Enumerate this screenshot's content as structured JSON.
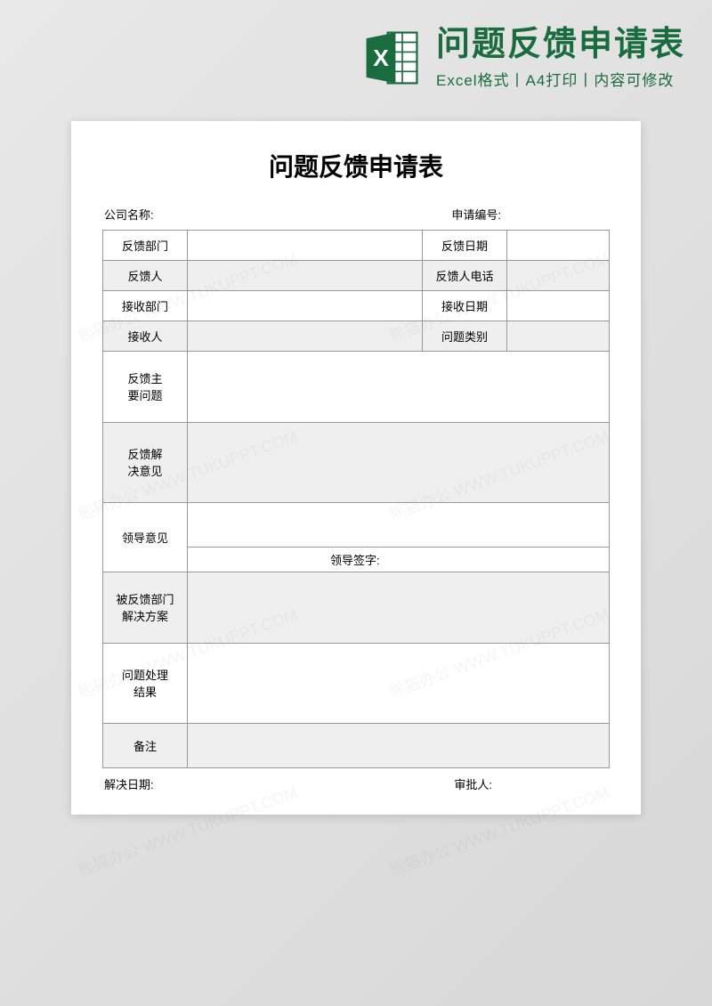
{
  "header": {
    "title": "问题反馈申请表",
    "subtitle": "Excel格式丨A4打印丨内容可修改",
    "icon_name": "excel-icon"
  },
  "form": {
    "title": "问题反馈申请表",
    "top": {
      "company_label": "公司名称:",
      "app_no_label": "申请编号:"
    },
    "rows": {
      "r1_left": "反馈部门",
      "r1_right": "反馈日期",
      "r2_left": "反馈人",
      "r2_right": "反馈人电话",
      "r3_left": "接收部门",
      "r3_right": "接收日期",
      "r4_left": "接收人",
      "r4_right": "问题类别",
      "main_issue": "反馈主\n要问题",
      "solution_opinion": "反馈解\n决意见",
      "leader_opinion": "领导意见",
      "leader_sign": "领导签字:",
      "dept_solution": "被反馈部门\n解决方案",
      "handle_result": "问题处理\n结果",
      "remark": "备注"
    },
    "bottom": {
      "resolve_date": "解决日期:",
      "approver": "审批人:"
    }
  },
  "watermark": "熊猫办公 WWW.TUKUPPT.COM"
}
